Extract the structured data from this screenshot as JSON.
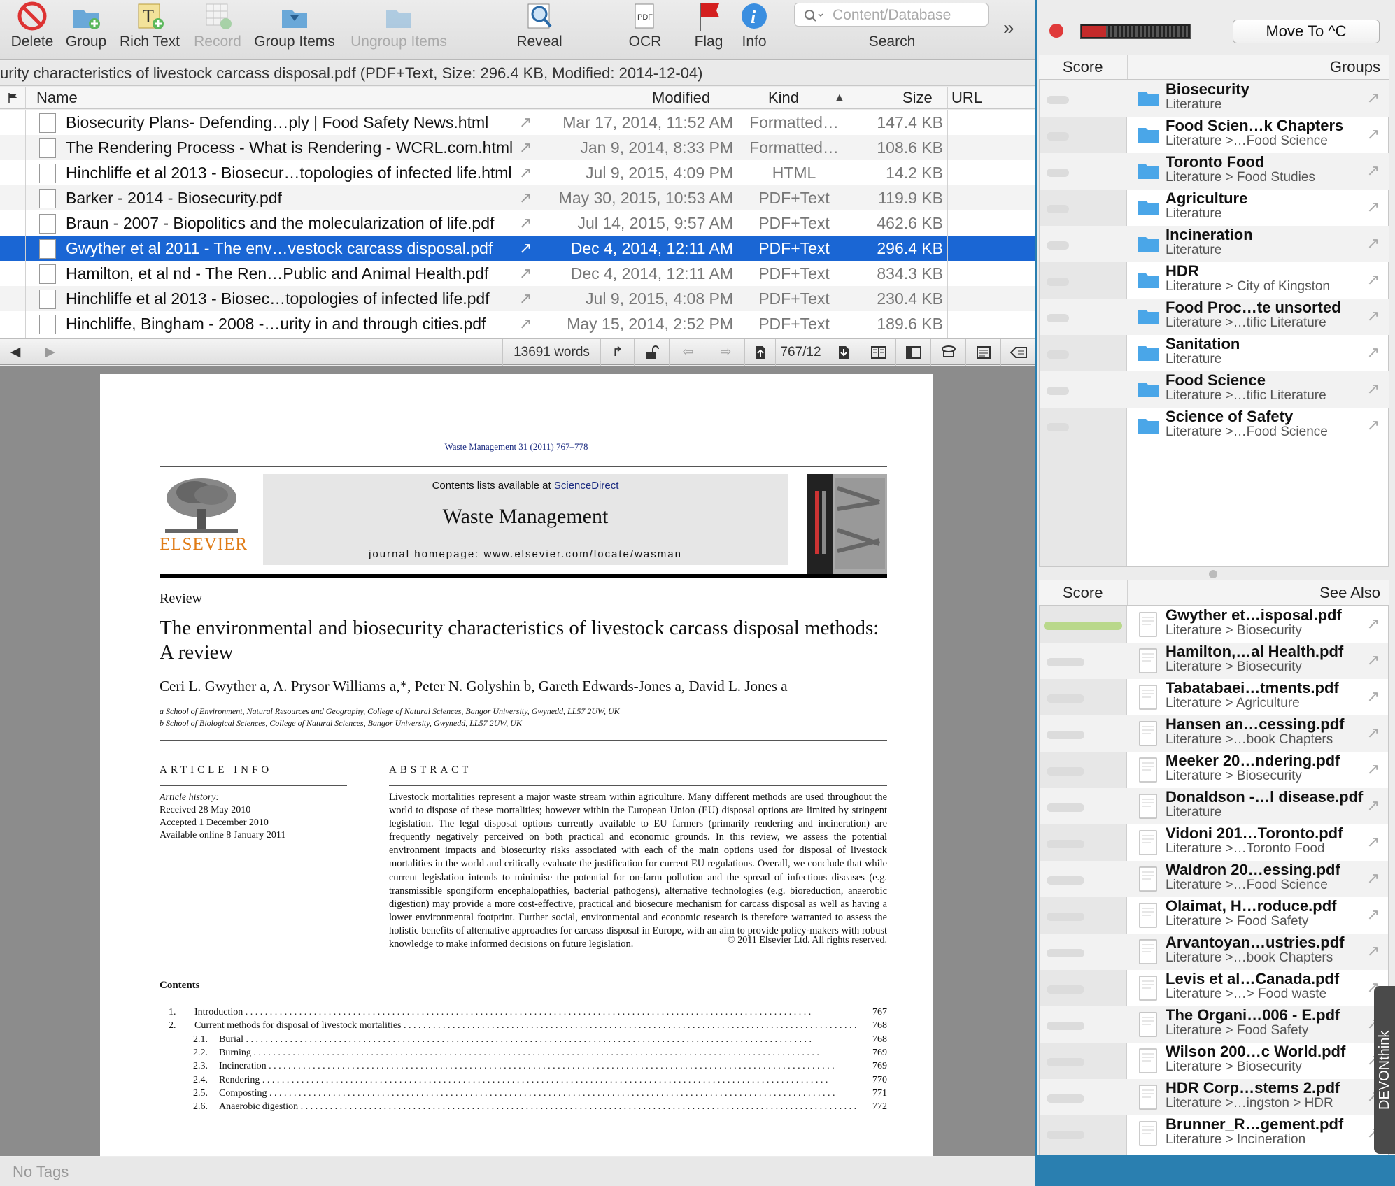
{
  "toolbar": {
    "delete": "Delete",
    "group": "Group",
    "rich_text": "Rich Text",
    "record": "Record",
    "group_items": "Group Items",
    "ungroup_items": "Ungroup Items",
    "reveal": "Reveal",
    "ocr": "OCR",
    "flag": "Flag",
    "info": "Info",
    "search_label": "Search",
    "search_placeholder": "Content/Database",
    "overflow": "»"
  },
  "pathbar": "urity characteristics of livestock carcass disposal.pdf (PDF+Text, Size: 296.4 KB, Modified: 2014-12-04)",
  "columns": {
    "name": "Name",
    "modified": "Modified",
    "kind": "Kind",
    "size": "Size",
    "url": "URL",
    "sort_indicator": "▲"
  },
  "rows": [
    {
      "name": "Biosecurity Plans- Defending…ply | Food Safety News.html",
      "modified": "Mar 17, 2014, 11:52 AM",
      "kind": "Formatted…",
      "size": "147.4 KB"
    },
    {
      "name": "The Rendering Process - What is Rendering - WCRL.com.html",
      "modified": "Jan 9, 2014, 8:33 PM",
      "kind": "Formatted…",
      "size": "108.6 KB"
    },
    {
      "name": "Hinchliffe et al 2013 - Biosecur…topologies of infected life.html",
      "modified": "Jul 9, 2015, 4:09 PM",
      "kind": "HTML",
      "size": "14.2 KB"
    },
    {
      "name": "Barker - 2014 - Biosecurity.pdf",
      "modified": "May 30, 2015, 10:53 AM",
      "kind": "PDF+Text",
      "size": "119.9 KB"
    },
    {
      "name": "Braun - 2007 - Biopolitics and the molecularization of life.pdf",
      "modified": "Jul 14, 2015, 9:57 AM",
      "kind": "PDF+Text",
      "size": "462.6 KB"
    },
    {
      "name": "Gwyther et al 2011 - The env…vestock carcass disposal.pdf",
      "modified": "Dec 4, 2014, 12:11 AM",
      "kind": "PDF+Text",
      "size": "296.4 KB"
    },
    {
      "name": "Hamilton, et al nd - The Ren…Public and Animal Health.pdf",
      "modified": "Dec 4, 2014, 12:11 AM",
      "kind": "PDF+Text",
      "size": "834.3 KB"
    },
    {
      "name": "Hinchliffe et al 2013 - Biosec…topologies of infected life.pdf",
      "modified": "Jul 9, 2015, 4:08 PM",
      "kind": "PDF+Text",
      "size": "230.4 KB"
    },
    {
      "name": "Hinchliffe, Bingham - 2008 -…urity in and through cities.pdf",
      "modified": "May 15, 2014, 2:52 PM",
      "kind": "PDF+Text",
      "size": "189.6 KB"
    }
  ],
  "selected_row": 5,
  "navbar": {
    "words": "13691 words",
    "page": "767/12"
  },
  "document": {
    "journal_ref": "Waste Management 31 (2011) 767–778",
    "contents_available": "Contents lists available at",
    "sciencedirect": "ScienceDirect",
    "journal_name": "Waste Management",
    "homepage": "journal homepage: www.elsevier.com/locate/wasman",
    "publisher": "ELSEVIER",
    "section": "Review",
    "title": "The environmental and biosecurity characteristics of livestock carcass disposal methods: A review",
    "authors": "Ceri L. Gwyther a, A. Prysor Williams a,*, Peter N. Golyshin b, Gareth Edwards-Jones a, David L. Jones a",
    "affil_a": "a School of Environment, Natural Resources and Geography, College of Natural Sciences, Bangor University, Gwynedd, LL57 2UW, UK",
    "affil_b": "b School of Biological Sciences, College of Natural Sciences, Bangor University, Gwynedd, LL57 2UW, UK",
    "article_info": "ARTICLE INFO",
    "abstract_head": "ABSTRACT",
    "history_head": "Article history:",
    "received": "Received 28 May 2010",
    "accepted": "Accepted 1 December 2010",
    "online": "Available online 8 January 2011",
    "abstract": "Livestock mortalities represent a major waste stream within agriculture. Many different methods are used throughout the world to dispose of these mortalities; however within the European Union (EU) disposal options are limited by stringent legislation. The legal disposal options currently available to EU farmers (primarily rendering and incineration) are frequently negatively perceived on both practical and economic grounds. In this review, we assess the potential environment impacts and biosecurity risks associated with each of the main options used for disposal of livestock mortalities in the world and critically evaluate the justification for current EU regulations. Overall, we conclude that while current legislation intends to minimise the potential for on-farm pollution and the spread of infectious diseases (e.g. transmissible spongiform encephalopathies, bacterial pathogens), alternative technologies (e.g. bioreduction, anaerobic digestion) may provide a more cost-effective, practical and biosecure mechanism for carcass disposal as well as having a lower environmental footprint. Further social, environmental and economic research is therefore warranted to assess the holistic benefits of alternative approaches for carcass disposal in Europe, with an aim to provide policy-makers with robust knowledge to make informed decisions on future legislation.",
    "copyright": "© 2011 Elsevier Ltd. All rights reserved.",
    "contents_head": "Contents",
    "toc": [
      {
        "num": "1.",
        "title": "Introduction",
        "page": "767"
      },
      {
        "num": "2.",
        "title": "Current methods for disposal of livestock mortalities",
        "page": "768"
      },
      {
        "num": "2.1.",
        "title": "Burial",
        "page": "768"
      },
      {
        "num": "2.2.",
        "title": "Burning",
        "page": "769"
      },
      {
        "num": "2.3.",
        "title": "Incineration",
        "page": "769"
      },
      {
        "num": "2.4.",
        "title": "Rendering",
        "page": "770"
      },
      {
        "num": "2.5.",
        "title": "Composting",
        "page": "771"
      },
      {
        "num": "2.6.",
        "title": "Anaerobic digestion",
        "page": "772"
      }
    ]
  },
  "status": "No Tags",
  "side": {
    "move_to": "Move To ^C",
    "groups_hdr": {
      "score": "Score",
      "groups": "Groups"
    },
    "groups": [
      {
        "t1": "Biosecurity",
        "t2": "Literature"
      },
      {
        "t1": "Food Scien…k Chapters",
        "t2": "Literature >…Food Science"
      },
      {
        "t1": "Toronto Food",
        "t2": "Literature > Food Studies"
      },
      {
        "t1": "Agriculture",
        "t2": "Literature"
      },
      {
        "t1": "Incineration",
        "t2": "Literature"
      },
      {
        "t1": "HDR",
        "t2": "Literature > City of Kingston"
      },
      {
        "t1": "Food Proc…te unsorted",
        "t2": "Literature >…tific Literature"
      },
      {
        "t1": "Sanitation",
        "t2": "Literature"
      },
      {
        "t1": "Food Science",
        "t2": "Literature >…tific Literature"
      },
      {
        "t1": "Science of Safety",
        "t2": "Literature >…Food Science"
      }
    ],
    "seealso_hdr": {
      "score": "Score",
      "see_also": "See Also"
    },
    "seealso": [
      {
        "t1": "Gwyther et…isposal.pdf",
        "t2": "Literature > Biosecurity"
      },
      {
        "t1": "Hamilton,…al Health.pdf",
        "t2": "Literature > Biosecurity"
      },
      {
        "t1": "Tabatabaei…tments.pdf",
        "t2": "Literature > Agriculture"
      },
      {
        "t1": "Hansen an…cessing.pdf",
        "t2": "Literature >…book Chapters"
      },
      {
        "t1": "Meeker 20…ndering.pdf",
        "t2": "Literature > Biosecurity"
      },
      {
        "t1": "Donaldson -…l disease.pdf",
        "t2": "Literature"
      },
      {
        "t1": "Vidoni 201…Toronto.pdf",
        "t2": "Literature >…Toronto Food"
      },
      {
        "t1": "Waldron 20…essing.pdf",
        "t2": "Literature >…Food Science"
      },
      {
        "t1": "Olaimat, H…roduce.pdf",
        "t2": "Literature > Food Safety"
      },
      {
        "t1": "Arvantoyan…ustries.pdf",
        "t2": "Literature >…book Chapters"
      },
      {
        "t1": "Levis et al…Canada.pdf",
        "t2": "Literature >…> Food waste"
      },
      {
        "t1": "The Organi…006 - E.pdf",
        "t2": "Literature > Food Safety"
      },
      {
        "t1": "Wilson 200…c World.pdf",
        "t2": "Literature > Biosecurity"
      },
      {
        "t1": "HDR Corp…stems 2.pdf",
        "t2": "Literature >…ingston > HDR"
      },
      {
        "t1": "Brunner_R…gement.pdf",
        "t2": "Literature > Incineration"
      }
    ]
  },
  "devon_tab": "DEVONthink",
  "colors": {
    "selection": "#1a66d4",
    "folder": "#4aa6e8",
    "score_top": "#b9d88b",
    "record_red": "#e03a3a"
  }
}
